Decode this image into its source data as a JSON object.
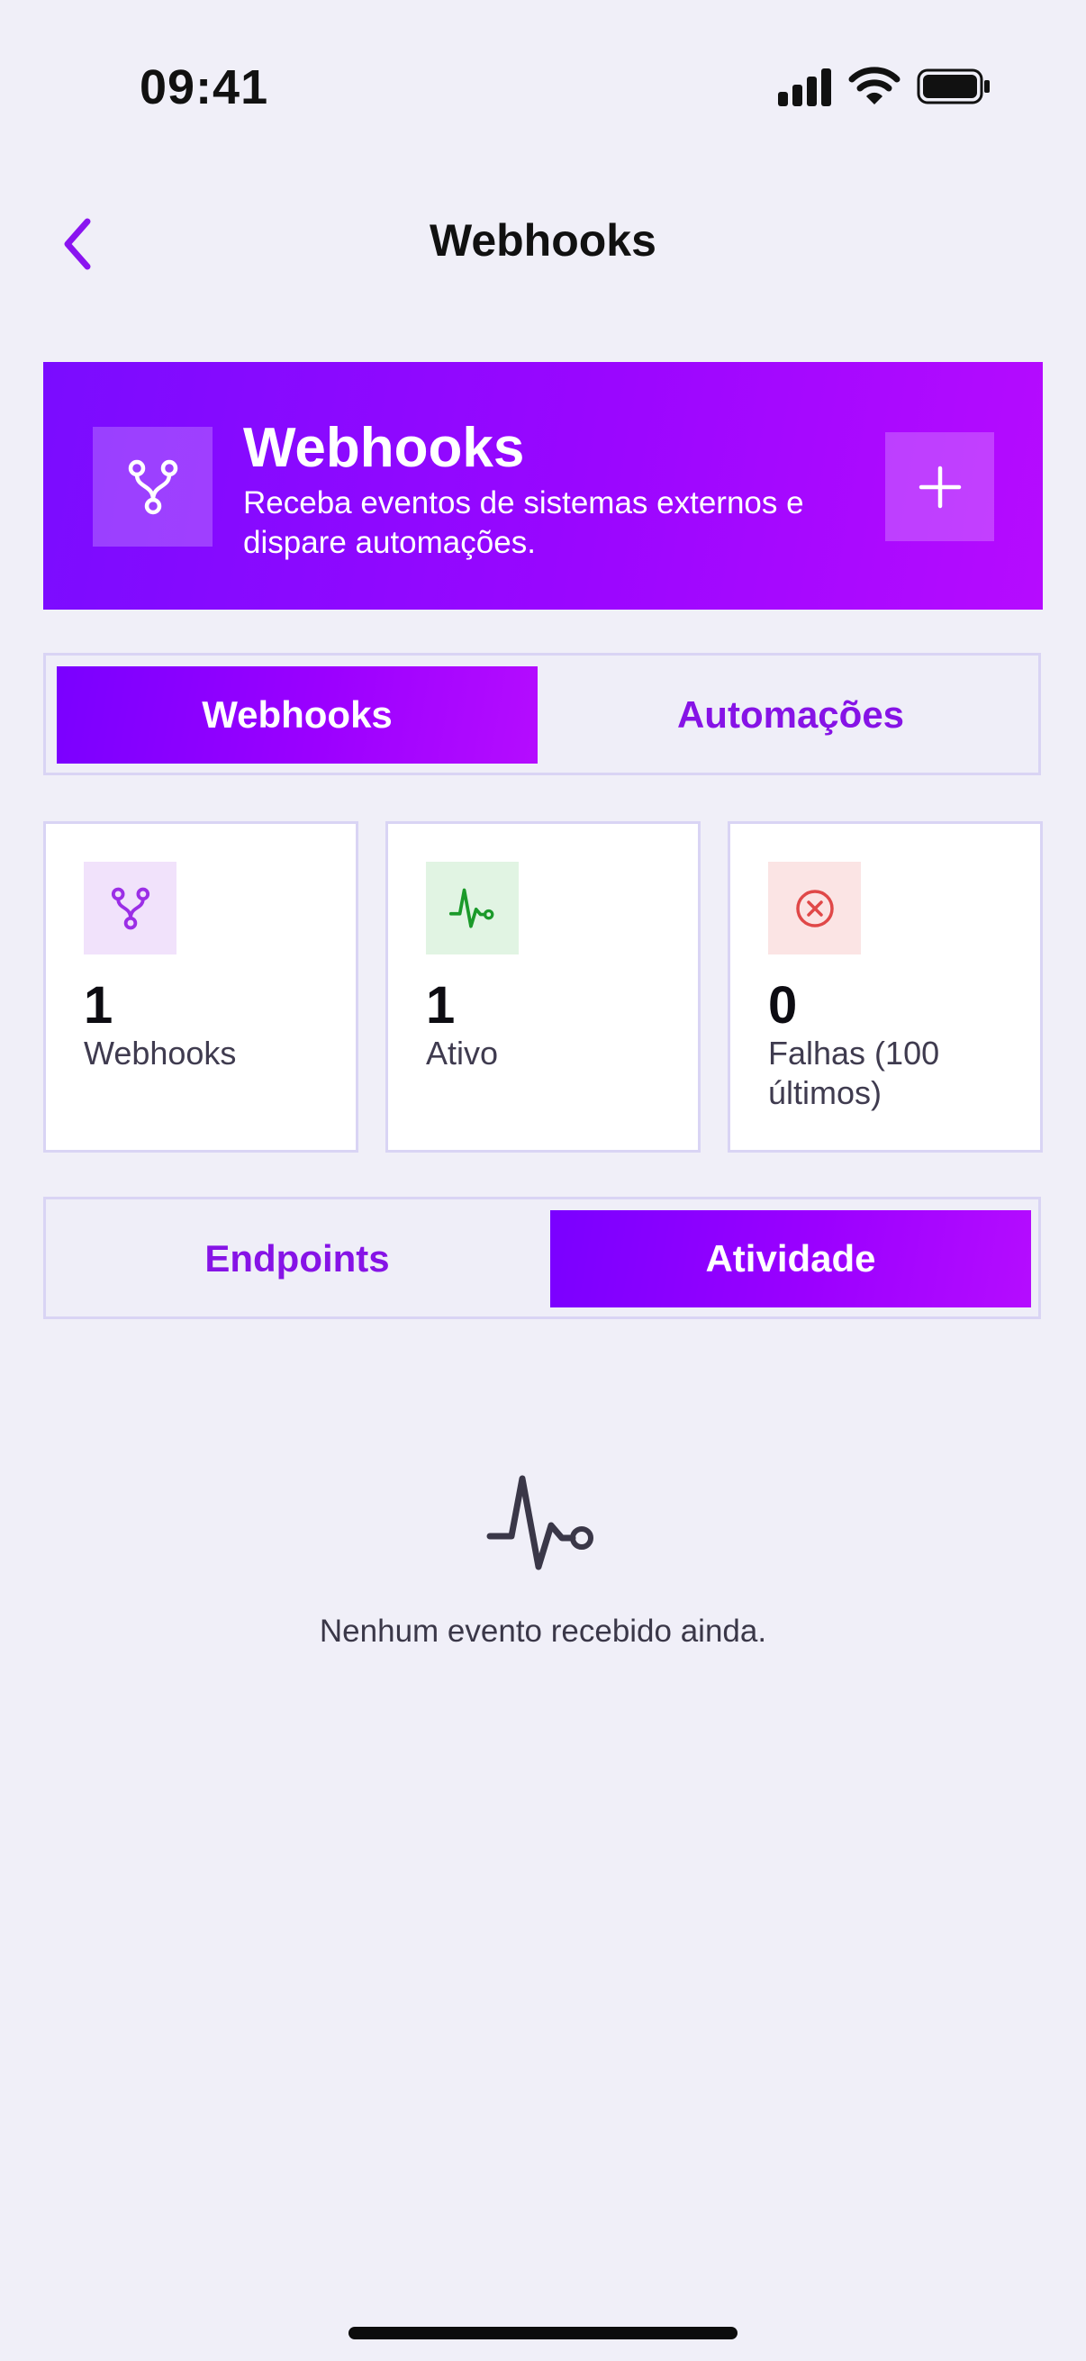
{
  "status_bar": {
    "time": "09:41"
  },
  "nav": {
    "title": "Webhooks",
    "back_icon": "chevron-left-icon"
  },
  "hero": {
    "title": "Webhooks",
    "subtitle": "Receba eventos de sistemas externos e dispare automações.",
    "icon": "webhook-icon",
    "add_icon": "plus-icon"
  },
  "main_tabs": [
    {
      "label": "Webhooks",
      "active": true
    },
    {
      "label": "Automações",
      "active": false
    }
  ],
  "stats": [
    {
      "value": "1",
      "label": "Webhooks",
      "icon": "webhook-icon",
      "color": "#9b2ee6"
    },
    {
      "value": "1",
      "label": "Ativo",
      "icon": "activity-icon",
      "color": "#1b9a2a"
    },
    {
      "value": "0",
      "label": "Falhas (100 últimos)",
      "icon": "error-circle-icon",
      "color": "#e04848"
    }
  ],
  "sub_tabs": [
    {
      "label": "Endpoints",
      "active": false
    },
    {
      "label": "Atividade",
      "active": true
    }
  ],
  "empty_state": {
    "icon": "activity-icon",
    "text": "Nenhum evento recebido ainda."
  },
  "colors": {
    "accent_start": "#7a00ff",
    "accent_end": "#b50cff",
    "background": "#f0eff8",
    "tab_inactive_text": "#8613e6"
  }
}
